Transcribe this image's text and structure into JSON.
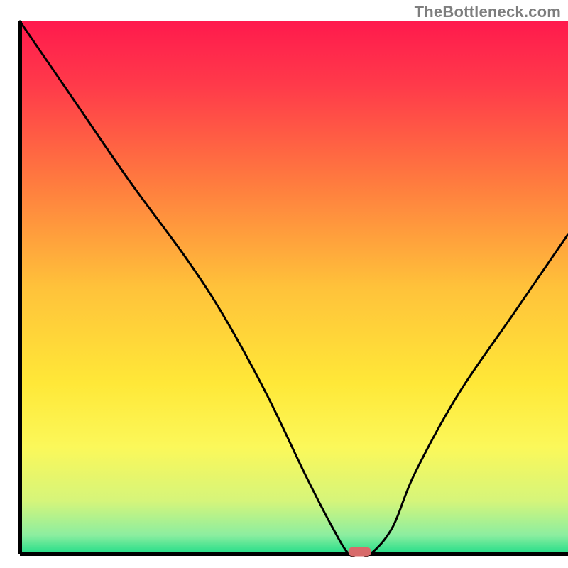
{
  "attribution": "TheBottleneck.com",
  "chart_data": {
    "type": "line",
    "title": "",
    "xlabel": "",
    "ylabel": "",
    "xlim": [
      0,
      100
    ],
    "ylim": [
      0,
      100
    ],
    "grid": false,
    "legend": false,
    "series": [
      {
        "name": "bottleneck-curve",
        "x": [
          0,
          10,
          20,
          30,
          37,
          45,
          52,
          57,
          60,
          62,
          64,
          68,
          72,
          80,
          90,
          100
        ],
        "y": [
          100,
          85,
          70,
          56,
          45,
          30,
          15,
          5,
          0,
          0,
          0,
          5,
          15,
          30,
          45,
          60
        ]
      }
    ],
    "marker": {
      "name": "optimal-point",
      "x": 62,
      "y": 0,
      "color": "#d86a6a"
    },
    "background_gradient": {
      "type": "vertical",
      "stops": [
        {
          "pos": 0.0,
          "color": "#ff1a4d"
        },
        {
          "pos": 0.12,
          "color": "#ff3a4a"
        },
        {
          "pos": 0.3,
          "color": "#ff7a3f"
        },
        {
          "pos": 0.5,
          "color": "#ffc23a"
        },
        {
          "pos": 0.68,
          "color": "#ffe838"
        },
        {
          "pos": 0.8,
          "color": "#fbf85a"
        },
        {
          "pos": 0.9,
          "color": "#d6f57a"
        },
        {
          "pos": 0.965,
          "color": "#8ceea0"
        },
        {
          "pos": 1.0,
          "color": "#22dd88"
        }
      ]
    },
    "axis_color": "#000000",
    "line_color": "#000000"
  }
}
